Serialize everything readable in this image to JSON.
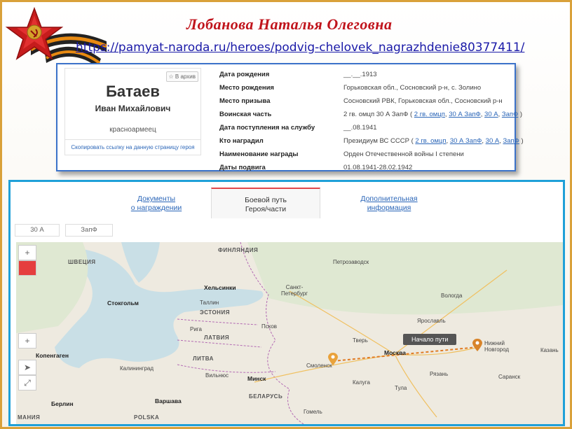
{
  "header": {
    "title": "Лобанова Наталья Олеговна",
    "link": "https://pamyat-naroda.ru/heroes/podvig-chelovek_nagrazhdenie80377411/"
  },
  "hero": {
    "surname": "Батаев",
    "given_name": "Иван Михайлович",
    "rank": "красноармеец",
    "archive_button": "☆ В архив",
    "copy_link": "Скопировать ссылку на данную страницу героя"
  },
  "facts": [
    {
      "label": "Дата рождения",
      "value": "__.__.1913"
    },
    {
      "label": "Место рождения",
      "value": "Горьковская обл., Сосновский р-н, с. Золино"
    },
    {
      "label": "Место призыва",
      "value": "Сосновский РВК, Горьковская обл., Сосновский р-н"
    },
    {
      "label": "Воинская часть",
      "value_prefix": "2 гв. омцп 30 А ЗапФ ( ",
      "links": [
        "2 гв. омцп",
        "30 А ЗапФ",
        "30 А",
        "ЗапФ"
      ],
      "value_suffix": " )"
    },
    {
      "label": "Дата поступления на службу",
      "value": "__.08.1941"
    },
    {
      "label": "Кто наградил",
      "value_prefix": "Президиум ВС СССР ( ",
      "links": [
        "2 гв. омцп",
        "30 А ЗапФ",
        "30 А",
        "ЗапФ"
      ],
      "value_suffix": " )"
    },
    {
      "label": "Наименование награды",
      "value": "Орден Отечественной войны I степени"
    },
    {
      "label": "Даты подвига",
      "value": "01.08.1941-28.02.1942"
    }
  ],
  "tabs": [
    {
      "line1": "Документы",
      "line2": "о награждении"
    },
    {
      "line1": "Боевой путь",
      "line2": "Героя/части"
    },
    {
      "line1": "Дополнительная",
      "line2": "информация"
    }
  ],
  "chips": [
    "30 А",
    "ЗапФ"
  ],
  "map": {
    "controls": [
      "+",
      "➤",
      "⤢"
    ],
    "tooltip": "Начало пути",
    "labels": {
      "finland": "ФИНЛЯНДИЯ",
      "sweden": "ШВЕЦИЯ",
      "helsinki": "Хельсинки",
      "stockholm": "Стокгольм",
      "spb": "Санкт-\nПетербург",
      "petrozavodsk": "Петрозаводск",
      "estonia": "ЭСТОНИЯ",
      "latvia": "ЛАТВИЯ",
      "lithuania": "ЛИТВА",
      "belarus": "БЕЛАРУСЬ",
      "minsk": "Минск",
      "moscow": "Москва",
      "smolensk": "Смоленск",
      "nn": "Нижний\nНовгород",
      "copenhagen": "Копенгаген",
      "warsaw": "Варшава",
      "berlin": "Берлин",
      "poland": "POLSKA",
      "germany": "МАНИЯ",
      "kaliningrad": "Калининград",
      "riga": "Рига",
      "vilnius": "Вильнюс",
      "tallinn": "Таллин",
      "saransk": "Саранск",
      "ryazan": "Рязань",
      "kaluga": "Калуга",
      "tula": "Тула",
      "tver": "Тверь",
      "yaroslavl": "Ярославль",
      "vologda": "Вологда",
      "pskov": "Псков",
      "gomel": "Гомель",
      "kazan": "Казань"
    }
  },
  "colors": {
    "title": "#c0141c",
    "link": "#1a1aa8",
    "frame": "#d9a13a",
    "panel_border": "#1fa0d8",
    "route": "#e07b24"
  }
}
